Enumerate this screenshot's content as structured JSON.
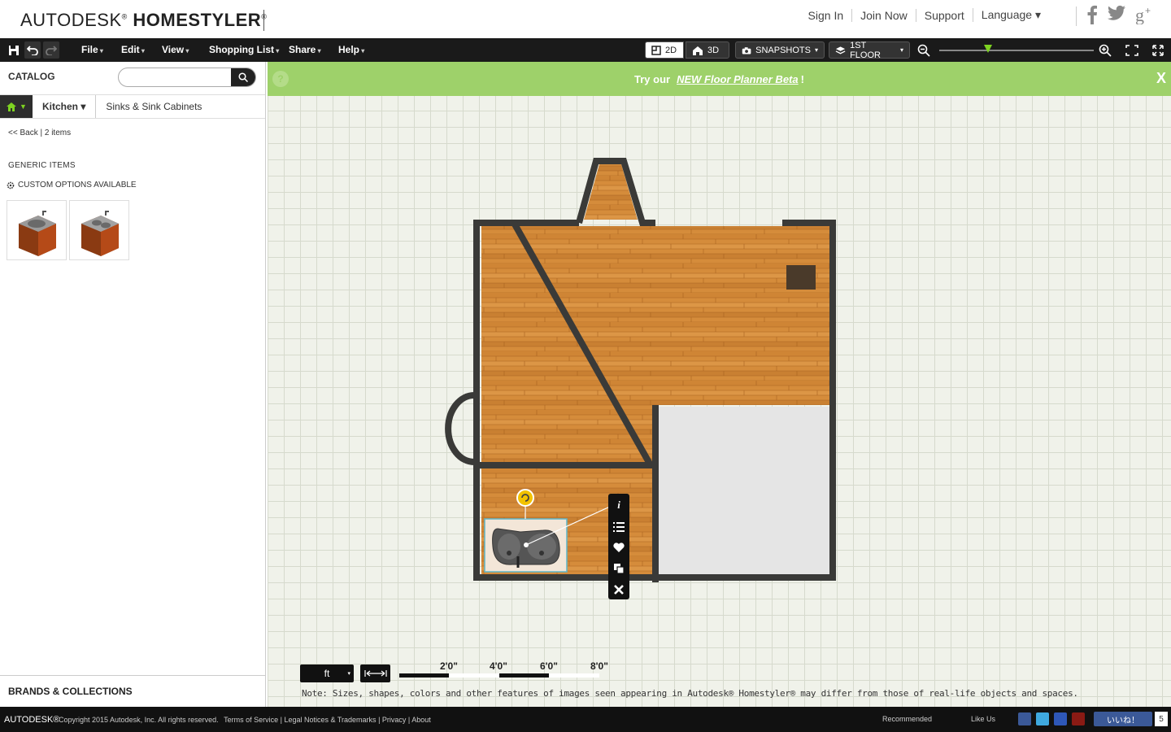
{
  "header": {
    "logo_light": "AUTODESK",
    "logo_bold": "HOMESTYLER",
    "sign_in": "Sign In",
    "join_now": "Join Now",
    "support": "Support",
    "language": "Language ▾"
  },
  "menubar": {
    "file": "File",
    "edit": "Edit",
    "view": "View",
    "shopping_list": "Shopping List",
    "share": "Share",
    "help": "Help",
    "view_2d": "2D",
    "view_3d": "3D",
    "snapshots": "SNAPSHOTS",
    "floor": "1ST FLOOR"
  },
  "sidebar": {
    "catalog_title": "CATALOG",
    "search_placeholder": "",
    "breadcrumb": [
      "Kitchen ▾",
      "Sinks & Sink Cabinets"
    ],
    "back": "<< Back",
    "item_count": "| 2 items",
    "generic_items": "GENERIC ITEMS",
    "custom_options": "CUSTOM OPTIONS AVAILABLE",
    "brands": "BRANDS & COLLECTIONS"
  },
  "banner": {
    "prefix": "Try our",
    "link": "NEW Floor Planner Beta",
    "suffix": "!",
    "close": "X"
  },
  "canvas": {
    "unit": "ft",
    "scale_labels": [
      "2'0\"",
      "4'0\"",
      "6'0\"",
      "8'0\""
    ],
    "note": "Note: Sizes, shapes, colors and other features of images seen appearing in Autodesk® Homestyler® may differ from those of real-life objects and spaces."
  },
  "footer": {
    "brand": "AUTODESK®",
    "copyright": "Copyright 2015 Autodesk, Inc. All rights reserved.",
    "terms": "Terms of Service",
    "legal": "Legal Notices & Trademarks",
    "privacy": "Privacy",
    "about": "About",
    "recommended": "Recommended",
    "like_us": "Like Us",
    "like_button": "いいね！",
    "like_count": "5"
  },
  "colors": {
    "accent_green": "#9ed16a",
    "wall": "#3a3a38",
    "wood": "#d28a3a",
    "toolbar": "#1a1a1a"
  }
}
